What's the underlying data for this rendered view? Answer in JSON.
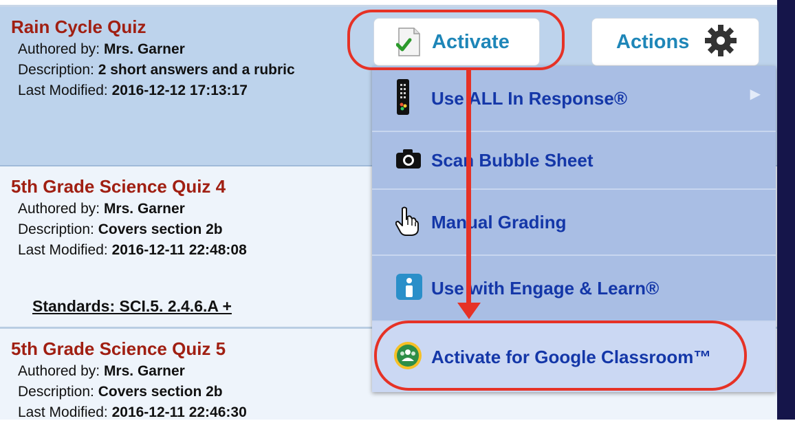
{
  "quizzes": [
    {
      "title": "Rain Cycle Quiz",
      "author_label": "Authored by:",
      "author": "Mrs. Garner",
      "description_label": "Description:",
      "description": "2 short answers and a rubric",
      "modified_label": "Last Modified:",
      "modified": "2016-12-12 17:13:17"
    },
    {
      "title": "5th Grade Science Quiz 4",
      "author_label": "Authored by:",
      "author": "Mrs. Garner",
      "description_label": "Description:",
      "description": "Covers section 2b",
      "modified_label": "Last Modified:",
      "modified": "2016-12-11 22:48:08",
      "standards": "Standards: SCI.5. 2.4.6.A +"
    },
    {
      "title": "5th Grade Science Quiz 5",
      "author_label": "Authored by:",
      "author": "Mrs. Garner",
      "description_label": "Description:",
      "description": "Covers section 2b",
      "modified_label": "Last Modified:",
      "modified": "2016-12-11 22:46:30"
    }
  ],
  "buttons": {
    "activate_label": "Activate",
    "actions_label": "Actions"
  },
  "menu": {
    "items": [
      {
        "label": "Use ALL In Response®",
        "icon": "response-device-icon",
        "has_submenu": true
      },
      {
        "label": "Scan Bubble Sheet",
        "icon": "camera-icon"
      },
      {
        "label": "Manual Grading",
        "icon": "hand-pointer-icon"
      },
      {
        "label": "Use with Engage & Learn®",
        "icon": "info-icon"
      },
      {
        "label": "Activate for Google Classroom™",
        "icon": "google-classroom-icon"
      }
    ]
  },
  "colors": {
    "quiz_title": "#a01f12",
    "button_text": "#1e86b8",
    "menu_text": "#1437a8",
    "menu_bg": "#a9bee4",
    "annotation": "#e63226"
  }
}
